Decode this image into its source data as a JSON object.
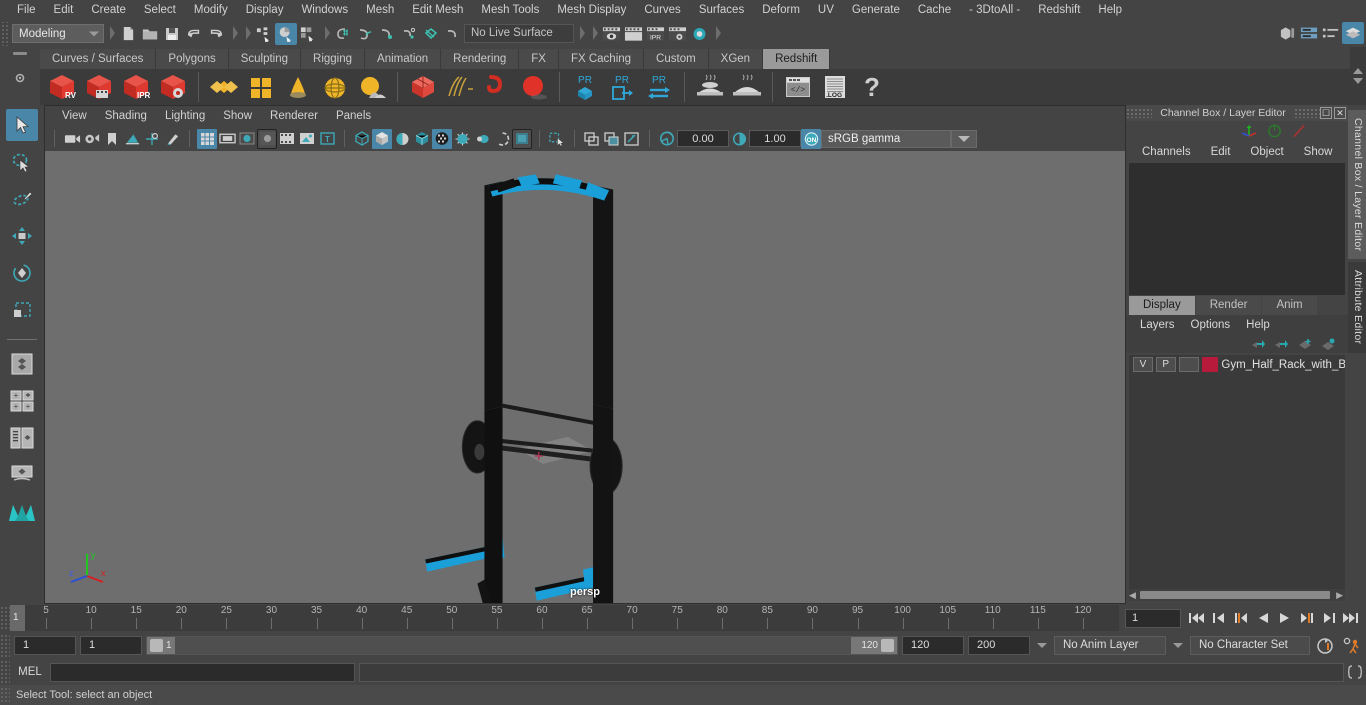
{
  "menubar": {
    "items": [
      "File",
      "Edit",
      "Create",
      "Select",
      "Modify",
      "Display",
      "Windows",
      "Mesh",
      "Edit Mesh",
      "Mesh Tools",
      "Mesh Display",
      "Curves",
      "Surfaces",
      "Deform",
      "UV",
      "Generate",
      "Cache",
      "- 3DtoAll -",
      "Redshift",
      "Help"
    ]
  },
  "statusline": {
    "menuset": "Modeling",
    "live_surface": "No Live Surface",
    "icons": [
      "new-scene-icon",
      "open-scene-icon",
      "save-scene-icon",
      "undo-icon",
      "redo-icon",
      "select-by-hierarchy-icon",
      "select-by-object-icon",
      "select-by-component-icon",
      "snap-to-grid-icon",
      "snap-to-curve-icon",
      "snap-to-point-icon",
      "snap-to-projected-center-icon",
      "snap-to-view-plane-icon",
      "make-live-icon",
      "render-view-icon",
      "render-sequence-icon",
      "ipr-render-icon",
      "render-settings-icon",
      "hypershade-icon",
      "render-globals-icon"
    ],
    "right_icons": [
      "show-hide-modeling-toolkit-icon",
      "show-hide-attribute-editor-icon",
      "show-hide-tool-settings-icon",
      "show-hide-channel-box-icon"
    ]
  },
  "shelf": {
    "tabs": [
      "Curves / Surfaces",
      "Polygons",
      "Sculpting",
      "Rigging",
      "Animation",
      "Rendering",
      "FX",
      "FX Caching",
      "Custom",
      "XGen",
      "Redshift"
    ],
    "active_tab": "Redshift",
    "buttons": [
      {
        "name": "redshift-render-view",
        "label": "RV"
      },
      {
        "name": "redshift-render-sequence",
        "label": ""
      },
      {
        "name": "redshift-ipr-render",
        "label": "IPR"
      },
      {
        "name": "redshift-render-settings",
        "label": ""
      },
      {
        "name": "redshift-area-light",
        "label": ""
      },
      {
        "name": "redshift-quad-light",
        "label": ""
      },
      {
        "name": "redshift-ies-light",
        "label": ""
      },
      {
        "name": "redshift-dome-light",
        "label": ""
      },
      {
        "name": "redshift-physical-sun",
        "label": ""
      },
      {
        "name": "redshift-proxy-mesh",
        "label": ""
      },
      {
        "name": "redshift-hair",
        "label": ""
      },
      {
        "name": "redshift-volume",
        "label": ""
      },
      {
        "name": "redshift-sphere",
        "label": ""
      },
      {
        "name": "redshift-pr-object",
        "label": "PR"
      },
      {
        "name": "redshift-pr-export",
        "label": "PR"
      },
      {
        "name": "redshift-pr-transfer",
        "label": "PR"
      },
      {
        "name": "redshift-bake-1",
        "label": ""
      },
      {
        "name": "redshift-bake-2",
        "label": ""
      },
      {
        "name": "redshift-script-editor",
        "label": ""
      },
      {
        "name": "redshift-log",
        "label": ".LOG"
      },
      {
        "name": "redshift-help",
        "label": "?"
      }
    ]
  },
  "toolbox": {
    "items": [
      "select-tool",
      "lasso-select-tool",
      "paint-select-tool",
      "move-tool",
      "rotate-tool",
      "scale-tool",
      "last-tool-used",
      "snap-quad-draw",
      "layout-two-pane-icon",
      "layout-four-pane-icon",
      "layout-outliner-persp-icon",
      "layout-hypergraph-icon",
      "layout-persp-icon",
      "maya-logo-icon"
    ],
    "selected": "select-tool"
  },
  "viewport": {
    "menu": [
      "View",
      "Shading",
      "Lighting",
      "Show",
      "Renderer",
      "Panels"
    ],
    "camera_label": "persp",
    "exposure": "0.00",
    "gamma": "1.00",
    "color_management": "sRGB gamma",
    "toolbar_icons": [
      "select-camera-icon",
      "camera-attributes-icon",
      "bookmark-icon",
      "image-plane-icon",
      "2d-pan-zoom-icon",
      "grease-pencil-icon",
      "grid-toggle-icon",
      "film-gate-icon",
      "resolution-gate-icon",
      "gate-mask-icon",
      "film-origin-icon",
      "safe-action-icon",
      "text-overlay-icon",
      "wireframe-icon",
      "smooth-shade-icon",
      "shaded-wireframe-icon",
      "use-default-material-icon",
      "textured-icon",
      "use-all-lights-icon",
      "shadows-icon",
      "screen-space-ao-icon",
      "motion-blur-icon",
      "multisample-icon",
      "depth-of-field-icon",
      "isolate-select-icon",
      "xray-icon",
      "xray-joints-icon",
      "xray-active-components-icon",
      "exposure-icon",
      "gamma-icon",
      "color-management-toggle-icon"
    ],
    "model_name": "Gym Half Rack with Barbell"
  },
  "channelbox": {
    "title": "Channel Box / Layer Editor",
    "menu": [
      "Channels",
      "Edit",
      "Object",
      "Show"
    ],
    "gizmos": [
      "transform-axes-icon",
      "rotate-manip-icon",
      "scale-manip-icon"
    ],
    "window_buttons": [
      "restore-icon",
      "close-icon"
    ]
  },
  "layereditor": {
    "tabs": [
      "Display",
      "Render",
      "Anim"
    ],
    "active_tab": "Display",
    "menu": [
      "Layers",
      "Options",
      "Help"
    ],
    "buttons": [
      "move-layer-up-icon",
      "move-layer-down-icon",
      "create-new-layer-icon",
      "create-layer-from-selected-icon"
    ],
    "layers": [
      {
        "visibility": "V",
        "playback": "P",
        "shading": "",
        "color": "#b81a3c",
        "name": "Gym_Half_Rack_with_B"
      }
    ]
  },
  "sidetabs": [
    "Channel Box / Layer Editor",
    "Attribute Editor"
  ],
  "timeslider": {
    "current_frame": "1",
    "current_frame_field": "1",
    "ticks": [
      5,
      10,
      15,
      20,
      25,
      30,
      35,
      40,
      45,
      50,
      55,
      60,
      65,
      70,
      75,
      80,
      85,
      90,
      95,
      100,
      105,
      110,
      115,
      120
    ],
    "range_start": 1,
    "range_end": 124,
    "playback_buttons": [
      "go-to-start-icon",
      "step-back-keyframe-icon",
      "step-back-frame-icon",
      "play-backwards-icon",
      "play-forwards-icon",
      "step-forward-frame-icon",
      "step-forward-keyframe-icon",
      "go-to-end-icon"
    ]
  },
  "rangeslider": {
    "anim_start": "1",
    "range_start": "1",
    "slider_left_label": "1",
    "slider_right_label": "120",
    "range_end": "120",
    "anim_end": "200",
    "anim_layer": "No Anim Layer",
    "character_set": "No Character Set",
    "right_icons": [
      "auto-key-icon",
      "animation-preferences-icon"
    ]
  },
  "commandline": {
    "language": "MEL",
    "input_value": "",
    "output_value": "",
    "script_editor_icon": "script-editor-icon"
  },
  "helpline": {
    "text": "Select Tool: select an object"
  },
  "colors": {
    "accent_blue": "#4a86a8",
    "shelf_red": "#d43b2f",
    "shelf_yellow": "#f0b429",
    "redshift_cyan": "#2fa8d8",
    "layer_red": "#b81a3c",
    "viewport_bg": "#6e6e6e",
    "model_blue": "#1b9fd8",
    "model_black": "#111111",
    "orange": "#e07b2a"
  }
}
